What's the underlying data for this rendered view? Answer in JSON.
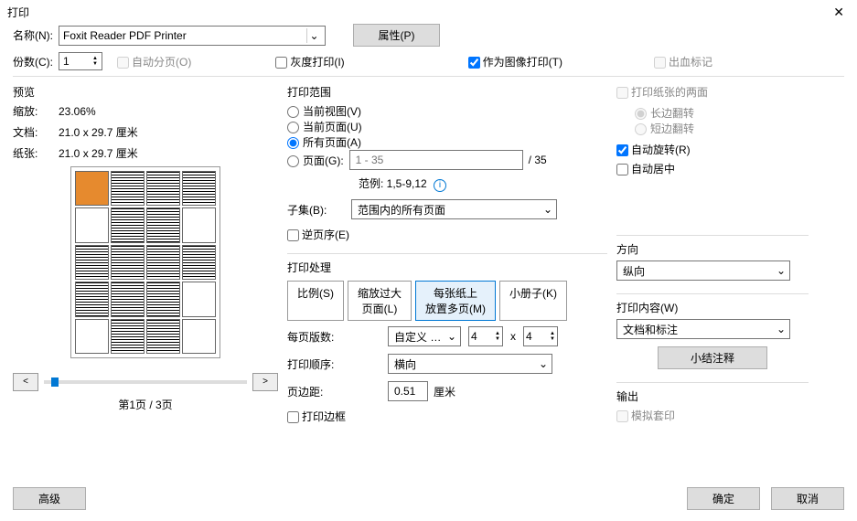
{
  "window": {
    "title": "打印",
    "close": "✕"
  },
  "top": {
    "name_label": "名称(N):",
    "printer": "Foxit Reader PDF Printer",
    "properties_btn": "属性(P)",
    "copies_label": "份数(C):",
    "copies_value": "1",
    "collate": "自动分页(O)",
    "grayscale": "灰度打印(I)",
    "as_image": "作为图像打印(T)",
    "bleed": "出血标记"
  },
  "preview": {
    "heading": "预览",
    "zoom_label": "缩放:",
    "zoom_value": "23.06%",
    "doc_label": "文档:",
    "doc_value": "21.0 x 29.7 厘米",
    "paper_label": "纸张:",
    "paper_value": "21.0 x 29.7 厘米",
    "prev": "<",
    "next": ">",
    "page_info": "第1页 / 3页"
  },
  "range": {
    "heading": "打印范围",
    "current_view": "当前视图(V)",
    "current_page": "当前页面(U)",
    "all_pages": "所有页面(A)",
    "pages_label": "页面(G):",
    "pages_placeholder": "1 - 35",
    "pages_total": "/ 35",
    "example_label": "范例: 1,5-9,12",
    "subset_label": "子集(B):",
    "subset_value": "范围内的所有页面",
    "reverse": "逆页序(E)"
  },
  "handling": {
    "heading": "打印处理",
    "tabs": {
      "size": "比例(S)",
      "poster": "缩放过大\n页面(L)",
      "multi": "每张纸上\n放置多页(M)",
      "booklet": "小册子(K)"
    },
    "per_sheet_label": "每页版数:",
    "per_sheet_value": "自定义 …",
    "per_sheet_x": "4",
    "per_sheet_y": "4",
    "x_sep": "x",
    "order_label": "打印顺序:",
    "order_value": "横向",
    "margin_label": "页边距:",
    "margin_value": "0.51",
    "margin_unit": "厘米",
    "border": "打印边框"
  },
  "right": {
    "duplex": "打印纸张的两面",
    "flip_long": "长边翻转",
    "flip_short": "短边翻转",
    "auto_rotate": "自动旋转(R)",
    "auto_center": "自动居中",
    "orientation_heading": "方向",
    "orientation_value": "纵向",
    "content_heading": "打印内容(W)",
    "content_value": "文档和标注",
    "summarize_btn": "小结注释",
    "output_heading": "输出",
    "simulate": "模拟套印"
  },
  "footer": {
    "advanced": "高级",
    "ok": "确定",
    "cancel": "取消"
  }
}
